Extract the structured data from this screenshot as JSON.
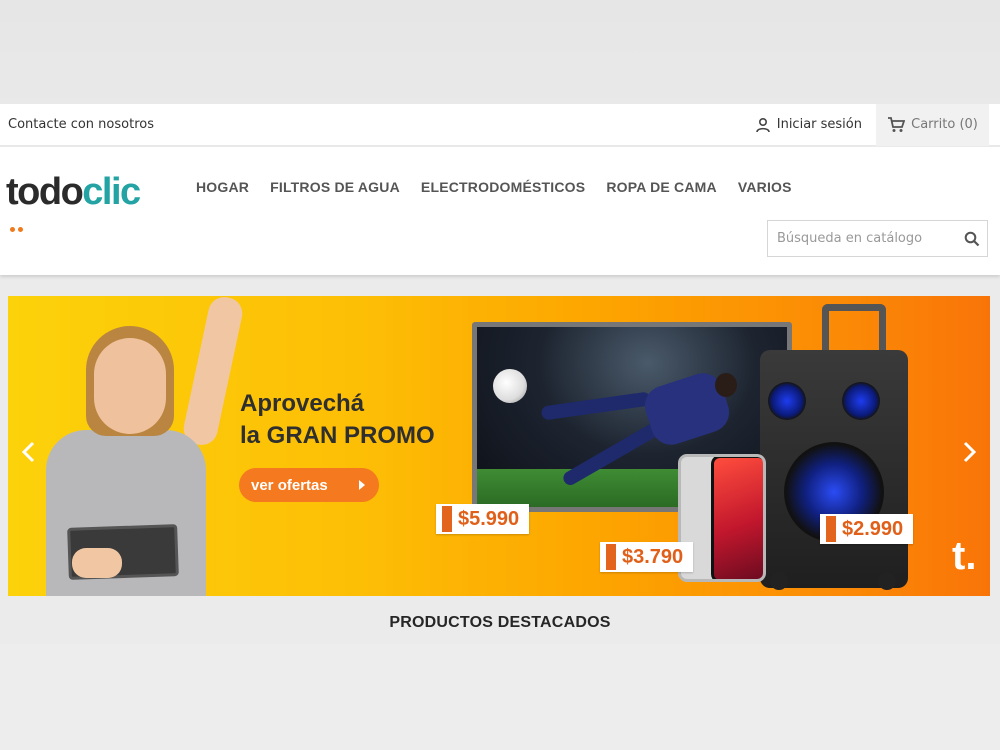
{
  "topbar": {
    "contact_label": "Contacte con nosotros",
    "signin_label": "Iniciar sesión",
    "cart_label": "Carrito (0)"
  },
  "header": {
    "logo_part1": "todo",
    "logo_part2": "clic",
    "nav": [
      "HOGAR",
      "FILTROS DE AGUA",
      "ELECTRODOMÉSTICOS",
      "ROPA DE CAMA",
      "VARIOS"
    ],
    "search_placeholder": "Búsqueda en catálogo"
  },
  "banner": {
    "headline_line1": "Aprovechá",
    "headline_line2": "la GRAN PROMO",
    "cta_label": "ver ofertas",
    "price_tv": "$5.990",
    "price_phone": "$3.790",
    "price_speaker": "$2.990",
    "brand_mark": "t."
  },
  "featured_title": "PRODUCTOS DESTACADOS",
  "colors": {
    "brand_teal": "#23a3a3",
    "brand_orange": "#f4791f",
    "banner_start": "#fcd20a",
    "banner_end": "#f97408"
  }
}
